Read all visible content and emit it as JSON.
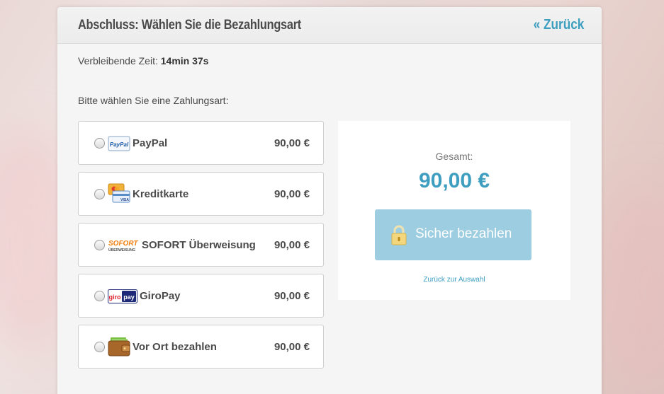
{
  "header": {
    "title": "Abschluss: Wählen Sie die Bezahlungsart",
    "back_label": "« Zurück"
  },
  "timer": {
    "label": "Verbleibende Zeit:",
    "value": "14min 37s"
  },
  "prompt": "Bitte wählen Sie eine Zahlungsart:",
  "payment_options": [
    {
      "label": "PayPal",
      "price": "90,00 €",
      "logo_text": "PayPal"
    },
    {
      "label": "Kreditkarte",
      "price": "90,00 €",
      "logo_text": "VISA"
    },
    {
      "label": "SOFORT Überweisung",
      "price": "90,00 €",
      "logo_text": "SOFORT",
      "logo_subtext": "ÜBERWEISUNG"
    },
    {
      "label": "GiroPay",
      "price": "90,00 €",
      "logo_text_left": "giro",
      "logo_text_right": "pay"
    },
    {
      "label": "Vor Ort bezahlen",
      "price": "90,00 €"
    }
  ],
  "summary": {
    "total_label": "Gesamt:",
    "total_value": "90,00 €",
    "pay_button_label": "Sicher bezahlen",
    "back_to_selection": "Zurück zur Auswahl"
  },
  "colors": {
    "accent": "#3d9ec0",
    "button": "#9dcde0"
  }
}
